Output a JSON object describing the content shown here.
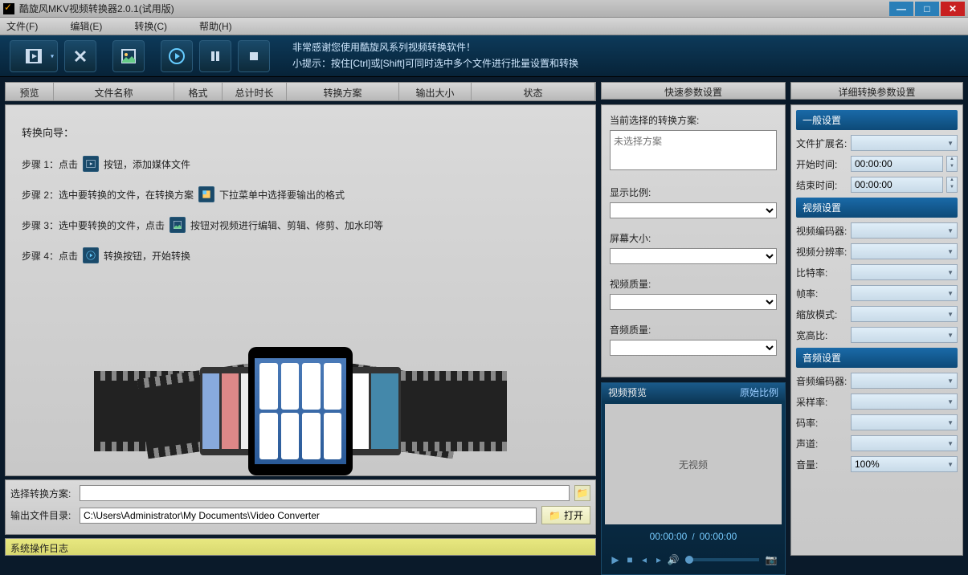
{
  "titlebar": {
    "title": "酷旋风MKV视频转换器2.0.1(试用版)"
  },
  "menubar": {
    "file": "文件(F)",
    "edit": "编辑(E)",
    "convert": "转换(C)",
    "help": "帮助(H)"
  },
  "toolbar": {
    "tip1": "非常感谢您使用酷旋风系列视频转换软件！",
    "tip2": "小提示：按住[Ctrl]或[Shift]可同时选中多个文件进行批量设置和转换"
  },
  "list_header": {
    "preview": "预览",
    "name": "文件名称",
    "format": "格式",
    "duration": "总计时长",
    "scheme": "转换方案",
    "outsize": "输出大小",
    "status": "状态"
  },
  "wizard": {
    "title": "转换向导：",
    "step1_a": "步骤 1：点击",
    "step1_b": "按钮，添加媒体文件",
    "step2_a": "步骤 2：选中要转换的文件，在转换方案",
    "step2_b": "下拉菜单中选择要输出的格式",
    "step3_a": "步骤 3：选中要转换的文件，点击",
    "step3_b": "按钮对视频进行编辑、剪辑、修剪、加水印等",
    "step4_a": "步骤 4：点击",
    "step4_b": "转换按钮，开始转换"
  },
  "bottom": {
    "scheme_label": "选择转换方案:",
    "scheme_value": "",
    "outdir_label": "输出文件目录:",
    "outdir_value": "C:\\Users\\Administrator\\My Documents\\Video Converter",
    "open_btn": "打开",
    "log": "系统操作日志"
  },
  "quick": {
    "title": "快速参数设置",
    "current_scheme_label": "当前选择的转换方案:",
    "current_scheme_placeholder": "未选择方案",
    "display_ratio": "显示比例:",
    "screen_size": "屏幕大小:",
    "video_quality": "视频质量:",
    "audio_quality": "音频质量:"
  },
  "preview": {
    "title": "视频预览",
    "original_ratio": "原始比例",
    "no_video": "无视频",
    "time_cur": "00:00:00",
    "time_total": "00:00:00"
  },
  "detail": {
    "title": "详细转换参数设置",
    "general": {
      "hdr": "一般设置",
      "ext": "文件扩展名:",
      "start": "开始时间:",
      "end": "结束时间:",
      "start_val": "00:00:00",
      "end_val": "00:00:00"
    },
    "video": {
      "hdr": "视频设置",
      "encoder": "视频编码器:",
      "resolution": "视频分辨率:",
      "bitrate": "比特率:",
      "fps": "帧率:",
      "scale": "缩放模式:",
      "aspect": "宽高比:"
    },
    "audio": {
      "hdr": "音频设置",
      "encoder": "音频编码器:",
      "samplerate": "采样率:",
      "bitrate": "码率:",
      "channel": "声道:",
      "volume": "音量:",
      "volume_val": "100%"
    }
  }
}
